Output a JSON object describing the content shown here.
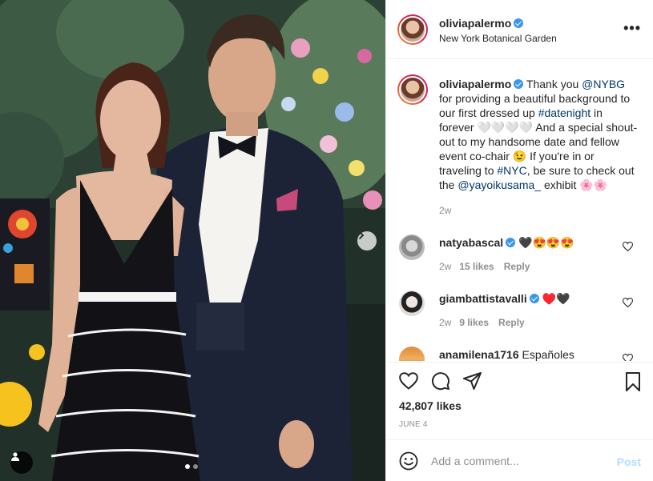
{
  "post": {
    "username": "oliviapalermo",
    "verified": true,
    "location": "New York Botanical Garden",
    "more_icon": "more-horizontal-icon"
  },
  "caption": {
    "username": "oliviapalermo",
    "parts": {
      "p1": "Thank you ",
      "mention1": "@NYBG",
      "p2": " for providing a beautiful background to our first dressed up ",
      "hashtag1": "#datenight",
      "p3": " in forever 🤍🤍🤍🤍 And a special shout-out to my handsome date and fellow event co-chair 😉 If you're in or traveling to ",
      "hashtag2": "#NYC",
      "p4": ", be sure to check out the ",
      "mention2": "@yayoikusama_",
      "p5": " exhibit 🌸🌸"
    },
    "time": "2w"
  },
  "comments": [
    {
      "username": "natyabascal",
      "text": "🖤😍😍😍",
      "time": "2w",
      "likes": "15 likes",
      "reply": "Reply",
      "verified": true
    },
    {
      "username": "giambattistavalli",
      "text": "♥️🖤",
      "time": "2w",
      "likes": "9 likes",
      "reply": "Reply",
      "verified": true
    },
    {
      "username": "anamilena1716",
      "text": "Españoles",
      "verified": false
    }
  ],
  "actions": {
    "likes": "42,807 likes",
    "date": "JUNE 4"
  },
  "add_comment": {
    "placeholder": "Add a comment...",
    "post_label": "Post"
  },
  "colors": {
    "link": "#00376b",
    "verified": "#3897f0",
    "post_disabled": "#b2dffc"
  },
  "carousel": {
    "total": 2,
    "active": 1
  }
}
